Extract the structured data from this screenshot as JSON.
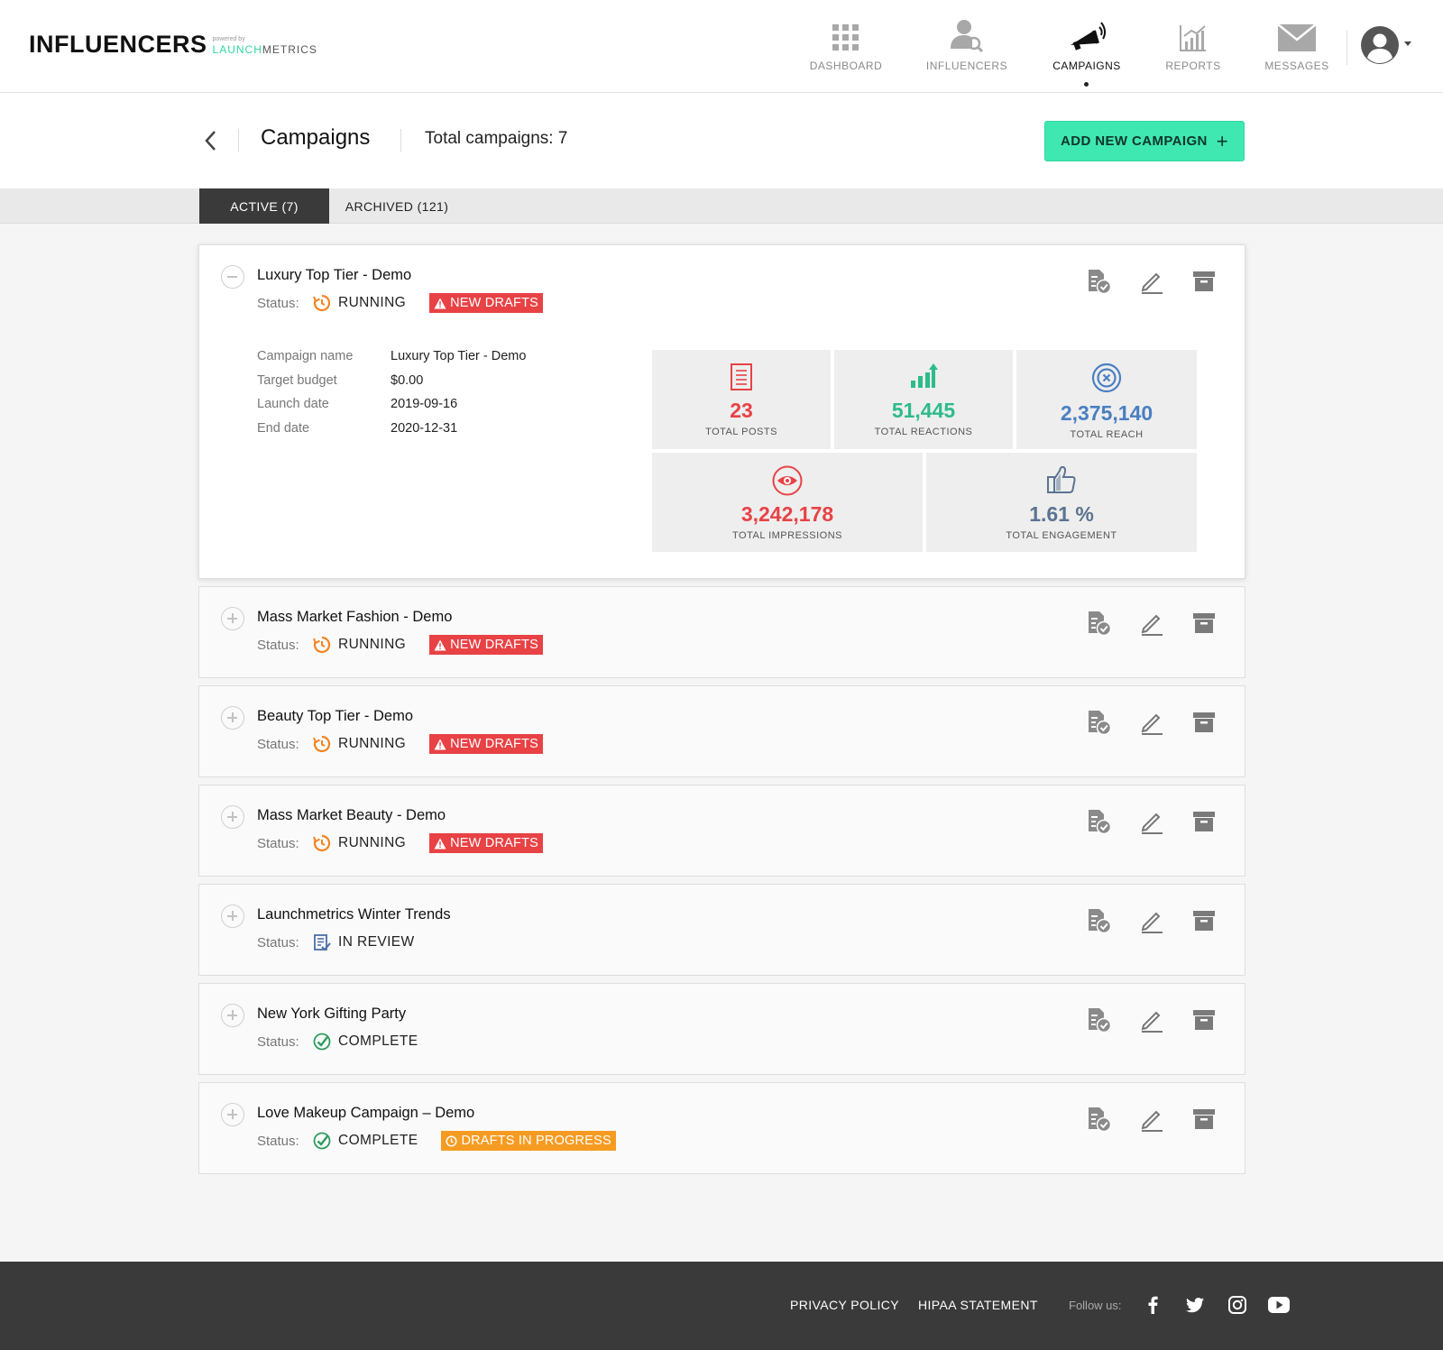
{
  "brand": {
    "name": "INFLUENCERS",
    "powered_by": "powered by",
    "partner_prefix": "LAUNCH",
    "partner_suffix": "METRICS"
  },
  "nav": {
    "items": [
      {
        "label": "DASHBOARD",
        "icon": "grid-icon"
      },
      {
        "label": "INFLUENCERS",
        "icon": "user-search-icon"
      },
      {
        "label": "CAMPAIGNS",
        "icon": "megaphone-icon",
        "active": true
      },
      {
        "label": "REPORTS",
        "icon": "bar-chart-icon"
      },
      {
        "label": "MESSAGES",
        "icon": "envelope-icon"
      }
    ]
  },
  "page": {
    "title": "Campaigns",
    "total": "Total campaigns: 7",
    "add_button": "ADD NEW CAMPAIGN",
    "add_plus": "+"
  },
  "tabs": {
    "active": "ACTIVE (7)",
    "archived": "ARCHIVED (121)"
  },
  "status_label": "Status:",
  "campaigns": [
    {
      "name": "Luxury Top Tier - Demo",
      "status": "RUNNING",
      "badge": "NEW DRAFTS",
      "expanded": true,
      "details": [
        {
          "label": "Campaign name",
          "value": "Luxury Top Tier - Demo"
        },
        {
          "label": "Target budget",
          "value": "$0.00"
        },
        {
          "label": "Launch date",
          "value": "2019-09-16"
        },
        {
          "label": "End date",
          "value": "2020-12-31"
        }
      ],
      "stats": [
        {
          "value": "23",
          "label": "TOTAL POSTS",
          "color": "#e84245",
          "icon": "document-icon"
        },
        {
          "value": "51,445",
          "label": "TOTAL REACTIONS",
          "color": "#2dbb8a",
          "icon": "trend-up-icon"
        },
        {
          "value": "2,375,140",
          "label": "TOTAL REACH",
          "color": "#4a7fc1",
          "icon": "target-icon"
        },
        {
          "value": "3,242,178",
          "label": "TOTAL IMPRESSIONS",
          "color": "#e84245",
          "icon": "eye-icon"
        },
        {
          "value": "1.61 %",
          "label": "TOTAL ENGAGEMENT",
          "color": "#5b7391",
          "icon": "thumbs-up-icon"
        }
      ]
    },
    {
      "name": "Mass Market Fashion - Demo",
      "status": "RUNNING",
      "badge": "NEW DRAFTS"
    },
    {
      "name": "Beauty Top Tier - Demo",
      "status": "RUNNING",
      "badge": "NEW DRAFTS"
    },
    {
      "name": "Mass Market Beauty - Demo",
      "status": "RUNNING",
      "badge": "NEW DRAFTS"
    },
    {
      "name": "Launchmetrics Winter Trends",
      "status": "IN REVIEW",
      "badge": ""
    },
    {
      "name": "New York Gifting Party",
      "status": "COMPLETE",
      "badge": ""
    },
    {
      "name": "Love Makeup Campaign – Demo",
      "status": "COMPLETE",
      "badge": "DRAFTS IN PROGRESS"
    }
  ],
  "colors": {
    "accent": "#3ee8b0",
    "badge_red": "#e84245",
    "badge_orange": "#f69b22",
    "running": "#f5821f",
    "complete": "#2d9c5c",
    "review": "#4a6fa5"
  },
  "footer": {
    "privacy": "PRIVACY POLICY",
    "hipaa": "HIPAA STATEMENT",
    "follow": "Follow us:",
    "social": [
      "facebook-icon",
      "twitter-icon",
      "instagram-icon",
      "youtube-icon"
    ]
  }
}
